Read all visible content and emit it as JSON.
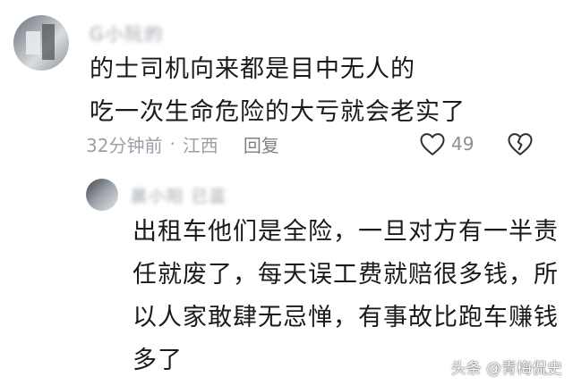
{
  "comment": {
    "user_name": "G小阮的",
    "lines": [
      "的士司机向来都是目中无人的",
      "吃一次生命危险的大亏就会老实了"
    ],
    "time": "32分钟前",
    "separator": "·",
    "location": "江西",
    "reply_label": "回复",
    "like_count": "49",
    "like_icon": "heart-outline-icon",
    "dislike_icon": "broken-heart-icon"
  },
  "reply": {
    "user_name": "晨小阳 已蓝",
    "lines": [
      "出租车他们是全险，一旦对方有一半责",
      "任就废了，每天误工费就赔很多钱，所",
      "以人家敢肆无忌惮，有事故比跑车赚钱",
      "多了"
    ]
  },
  "watermark": "头条 @青梅侃史",
  "colors": {
    "text": "#1a1a1a",
    "meta": "#9aa0a6"
  }
}
